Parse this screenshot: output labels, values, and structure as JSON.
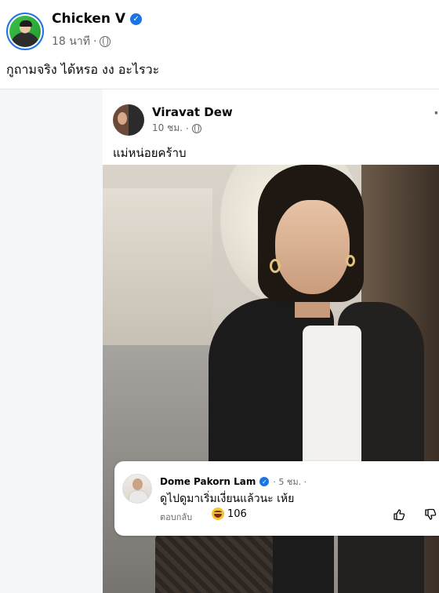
{
  "outer_post": {
    "author": "Chicken V",
    "time": "18 นาที",
    "text": "กูถามจริง ได้หรอ งง อะไรวะ"
  },
  "shared_post": {
    "author": "Viravat Dew",
    "time": "10 ชม.",
    "text": "แม่หน่อยคร้าบ",
    "more_label": "·"
  },
  "comment": {
    "author": "Dome Pakorn Lam",
    "time": "· 5 ชม. ·",
    "text": "ดูไปดูมาเริ่มเงี่ยนแล้วนะ เห้ย",
    "reply_label": "ตอบกลับ",
    "reaction_count": "106"
  },
  "icons": {
    "verified": "verified-badge-icon",
    "privacy": "globe-icon",
    "reaction": "laughing-emoji-icon",
    "like": "thumbs-up-icon",
    "dislike": "thumbs-down-icon"
  },
  "colors": {
    "accent": "#1b74e4",
    "secondary_text": "#65676b",
    "reaction": "#f7c331"
  }
}
